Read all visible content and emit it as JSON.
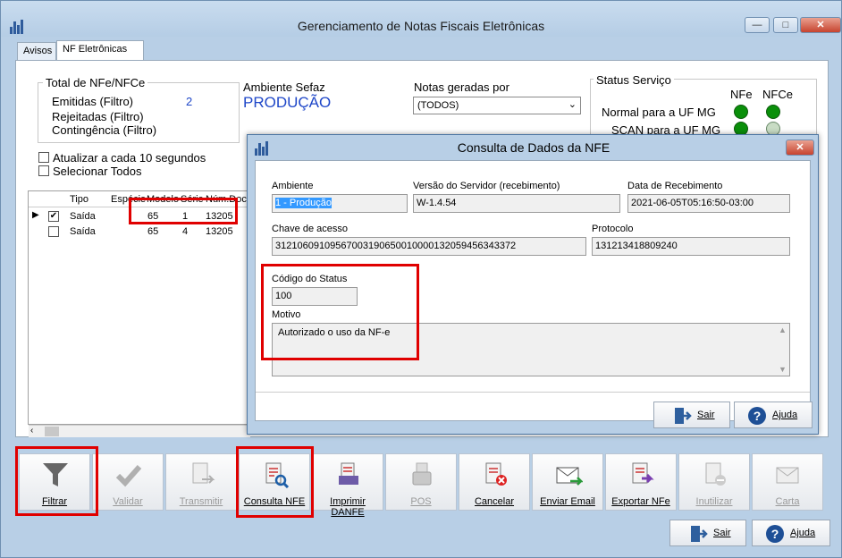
{
  "window": {
    "title": "Gerenciamento de Notas Fiscais Eletrônicas"
  },
  "tabs": [
    {
      "label": "Avisos"
    },
    {
      "label": "NF Eletrônicas"
    }
  ],
  "totals": {
    "title": "Total de NFe/NFCe",
    "emitidas_label": "Emitidas (Filtro)",
    "emitidas_value": "2",
    "rejeitadas_label": "Rejeitadas (Filtro)",
    "contingencia_label": "Contingência (Filtro)"
  },
  "ambiente": {
    "label": "Ambiente Sefaz",
    "value": "PRODUÇÃO"
  },
  "notas_geradas": {
    "label": "Notas geradas por",
    "value": "(TODOS)"
  },
  "status_servico": {
    "title": "Status Serviço",
    "col_nfe": "NFe",
    "col_nfce": "NFCe",
    "rows": [
      {
        "label": "Normal para a UF MG"
      },
      {
        "label": "SCAN para a UF MG"
      }
    ],
    "colors": {
      "online": "#0a8f0a",
      "inactive": "#c8dcc4"
    }
  },
  "options": {
    "atualizar_label": "Atualizar a cada 10 segundos",
    "selecionar_label": "Selecionar Todos"
  },
  "grid": {
    "headers": [
      "Tipo",
      "Espécie",
      "Modelo",
      "Série",
      "Núm.Doc."
    ],
    "rows": [
      {
        "checked": true,
        "tipo": "Saída",
        "modelo": "65",
        "serie": "1",
        "numero": "13205"
      },
      {
        "checked": false,
        "tipo": "Saída",
        "modelo": "65",
        "serie": "4",
        "numero": "13205"
      }
    ]
  },
  "toolbar": {
    "filtrar": "Filtrar",
    "validar": "Validar",
    "transmitir": "Transmitir",
    "consulta": "Consulta NFE",
    "imprimir": "Imprimir DANFE",
    "pos": "POS",
    "cancelar": "Cancelar",
    "enviar_email": "Enviar Email",
    "exportar": "Exportar NFe",
    "inutilizar": "Inutilizar",
    "carta": "Carta"
  },
  "footer": {
    "sair": "Sair",
    "ajuda": "Ajuda"
  },
  "dialog": {
    "title": "Consulta de Dados da NFE",
    "ambiente_label": "Ambiente",
    "ambiente_value": "1 - Produção",
    "versao_label": "Versão do Servidor (recebimento)",
    "versao_value": "W-1.4.54",
    "data_label": "Data de Recebimento",
    "data_value": "2021-06-05T05:16:50-03:00",
    "chave_label": "Chave de acesso",
    "chave_value": "31210609109567003190650010000132059456343372",
    "protocolo_label": "Protocolo",
    "protocolo_value": "131213418809240",
    "codigo_label": "Código do Status",
    "codigo_value": "100",
    "motivo_label": "Motivo",
    "motivo_value": "Autorizado o uso da NF-e",
    "sair": "Sair",
    "ajuda": "Ajuda"
  },
  "colors": {
    "highlight": "#e00000",
    "selection": "#3399ff"
  }
}
